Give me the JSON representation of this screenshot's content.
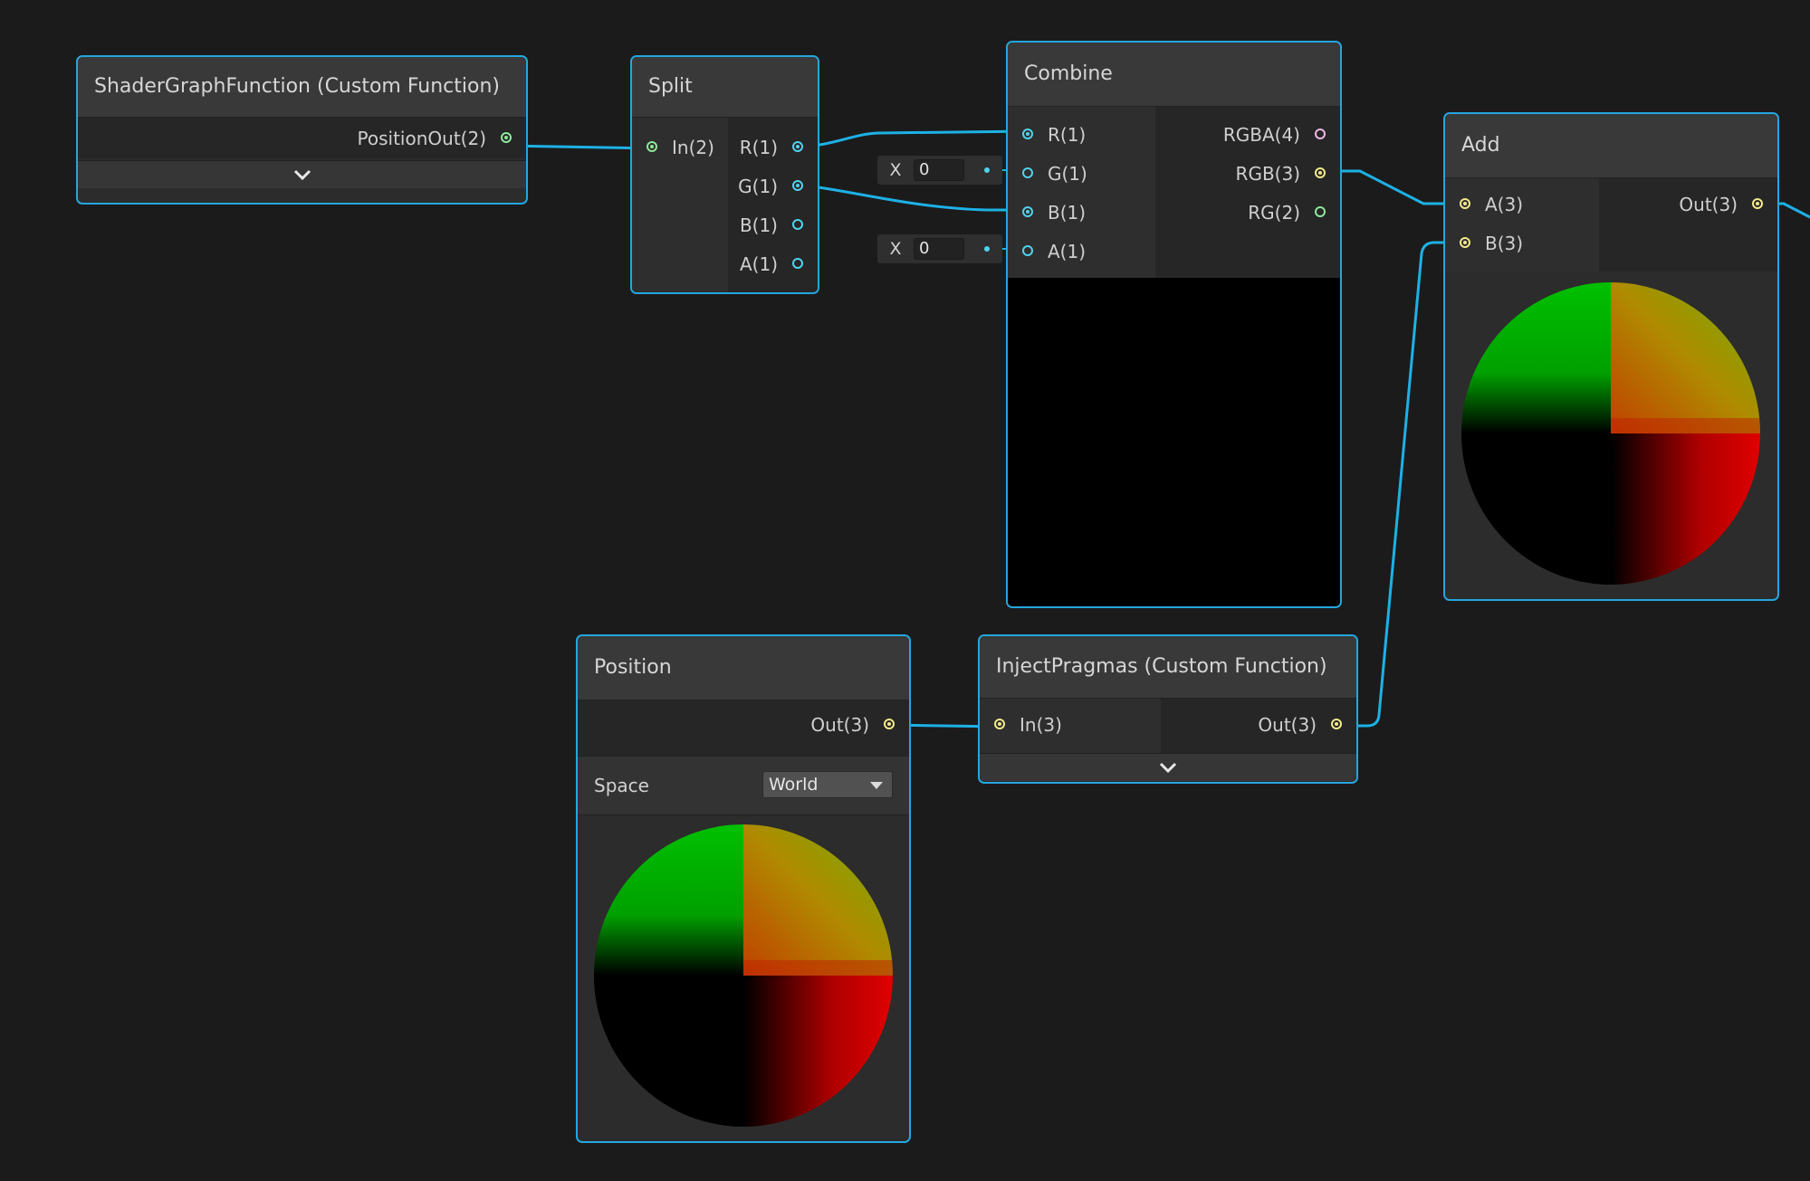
{
  "colors": {
    "canvas": "#1b1b1b",
    "selection": "#23a7de",
    "wire": "#1db1e6",
    "port_float": "#4fd2ee",
    "port_vec3": "#f0ea8a",
    "port_vec2": "#8fe89a",
    "port_vec4": "#f2b6e6"
  },
  "nodes": {
    "shader_fn": {
      "title": "ShaderGraphFunction (Custom Function)",
      "outputs": [
        "PositionOut(2)"
      ],
      "expand_icon": "chevron-down-icon"
    },
    "split": {
      "title": "Split",
      "inputs": [
        "In(2)"
      ],
      "outputs": [
        "R(1)",
        "G(1)",
        "B(1)",
        "A(1)"
      ]
    },
    "combine": {
      "title": "Combine",
      "inputs": [
        "R(1)",
        "G(1)",
        "B(1)",
        "A(1)"
      ],
      "outputs": [
        "RGBA(4)",
        "RGB(3)",
        "RG(2)"
      ],
      "default_g": {
        "label": "X",
        "value": "0"
      },
      "default_a": {
        "label": "X",
        "value": "0"
      }
    },
    "add": {
      "title": "Add",
      "inputs": [
        "A(3)",
        "B(3)"
      ],
      "outputs": [
        "Out(3)"
      ]
    },
    "position": {
      "title": "Position",
      "outputs": [
        "Out(3)"
      ],
      "space_label": "Space",
      "space_value": "World"
    },
    "inject": {
      "title": "InjectPragmas (Custom Function)",
      "inputs": [
        "In(3)"
      ],
      "outputs": [
        "Out(3)"
      ],
      "expand_icon": "chevron-down-icon"
    }
  }
}
